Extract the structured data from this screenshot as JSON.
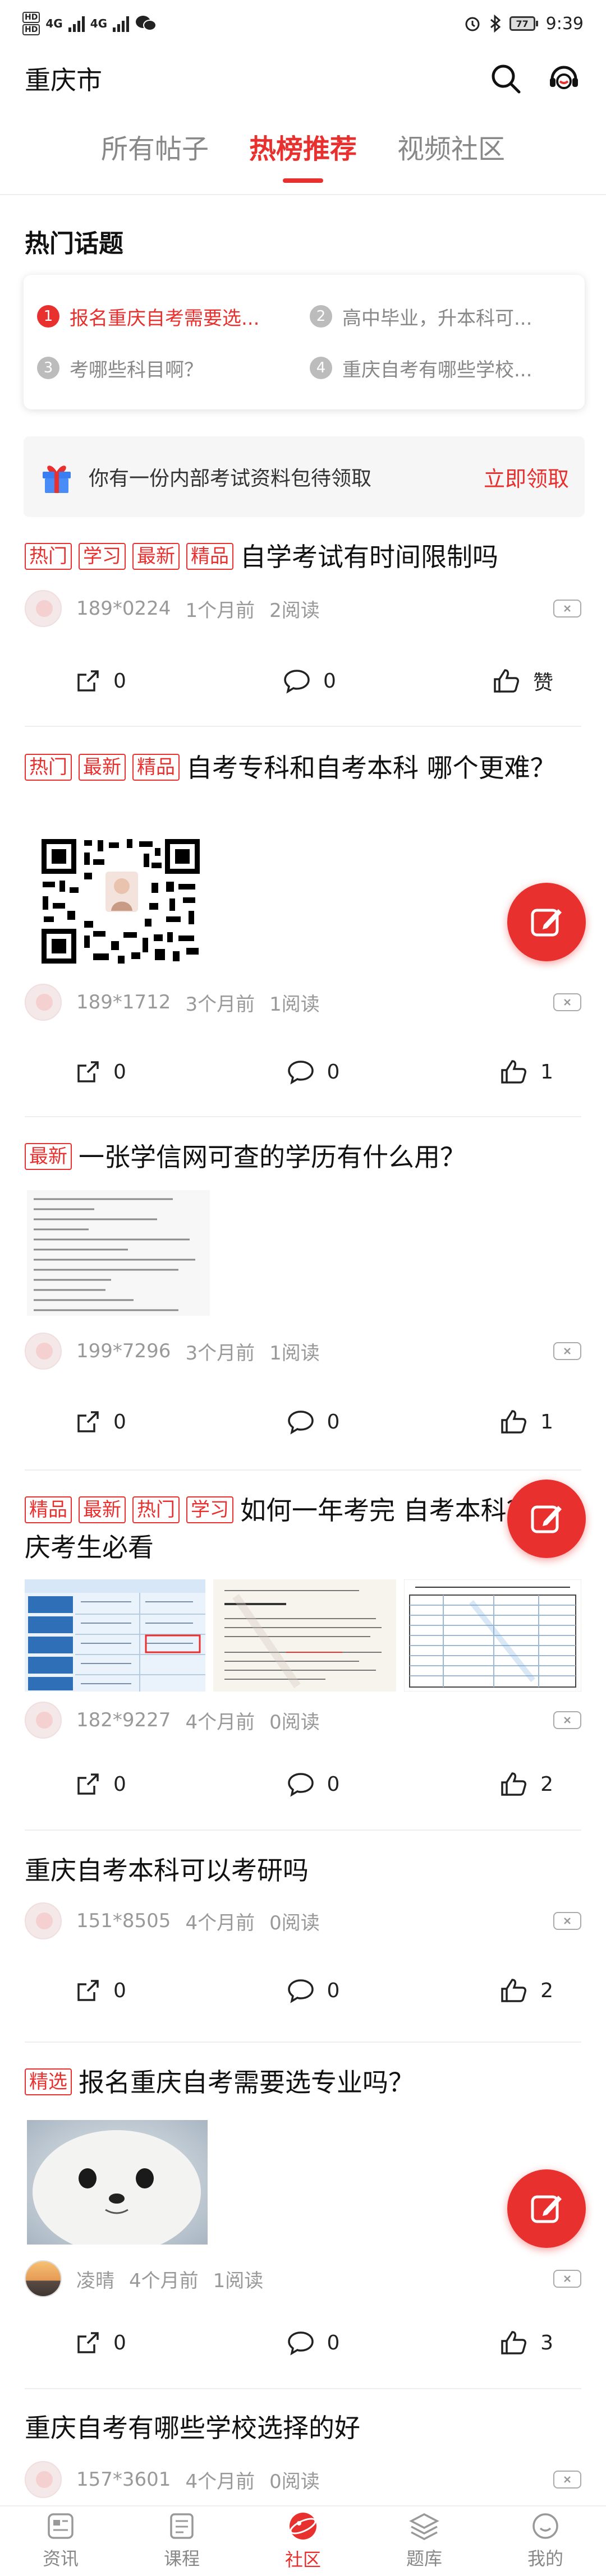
{
  "status_bar": {
    "left_badges": [
      "HD",
      "HD"
    ],
    "network": "4G",
    "time": "9:39",
    "battery": "77"
  },
  "header": {
    "city": "重庆市"
  },
  "tabs": [
    {
      "label": "所有帖子",
      "active": false
    },
    {
      "label": "热榜推荐",
      "active": true
    },
    {
      "label": "视频社区",
      "active": false
    }
  ],
  "hot_topics": {
    "title": "热门话题",
    "items": [
      {
        "num": "1",
        "text": "报名重庆自考需要选..."
      },
      {
        "num": "2",
        "text": "高中毕业，升本科可..."
      },
      {
        "num": "3",
        "text": "考哪些科目啊？"
      },
      {
        "num": "4",
        "text": "重庆自考有哪些学校..."
      }
    ]
  },
  "promo": {
    "text": "你有一份内部考试资料包待领取",
    "cta": "立即领取"
  },
  "posts": [
    {
      "tags": [
        "热门",
        "学习",
        "最新",
        "精品"
      ],
      "title": "自学考试有时间限制吗",
      "user": "189*0224",
      "time": "1个月前",
      "reads": "2阅读",
      "share": "0",
      "comments": "0",
      "likes": "赞"
    },
    {
      "tags": [
        "热门",
        "最新",
        "精品"
      ],
      "title": "自考专科和自考本科 哪个更难？",
      "user": "189*1712",
      "time": "3个月前",
      "reads": "1阅读",
      "share": "0",
      "comments": "0",
      "likes": "1"
    },
    {
      "tags": [
        "最新"
      ],
      "title": "一张学信网可查的学历有什么用？",
      "user": "199*7296",
      "time": "3个月前",
      "reads": "1阅读",
      "share": "0",
      "comments": "0",
      "likes": "1"
    },
    {
      "tags": [
        "精品",
        "最新",
        "热门",
        "学习"
      ],
      "title": "如何一年考完 自考本科？重庆考生必看",
      "user": "182*9227",
      "time": "4个月前",
      "reads": "0阅读",
      "share": "0",
      "comments": "0",
      "likes": "2"
    },
    {
      "tags": [],
      "title": "重庆自考本科可以考研吗",
      "user": "151*8505",
      "time": "4个月前",
      "reads": "0阅读",
      "share": "0",
      "comments": "0",
      "likes": "2"
    },
    {
      "tags": [
        "精选"
      ],
      "title": "报名重庆自考需要选专业吗？",
      "user": "凌晴",
      "time": "4个月前",
      "reads": "1阅读",
      "share": "0",
      "comments": "0",
      "likes": "3"
    },
    {
      "tags": [],
      "title": "重庆自考有哪些学校选择的好",
      "user": "157*3601",
      "time": "4个月前",
      "reads": "0阅读"
    }
  ],
  "bottom_nav": [
    {
      "label": "资讯",
      "icon": "news-icon",
      "active": false
    },
    {
      "label": "课程",
      "icon": "course-icon",
      "active": false
    },
    {
      "label": "社区",
      "icon": "community-icon",
      "active": true
    },
    {
      "label": "题库",
      "icon": "question-bank-icon",
      "active": false
    },
    {
      "label": "我的",
      "icon": "profile-icon",
      "active": false
    }
  ],
  "colors": {
    "accent": "#e8312f",
    "muted": "#999999"
  }
}
